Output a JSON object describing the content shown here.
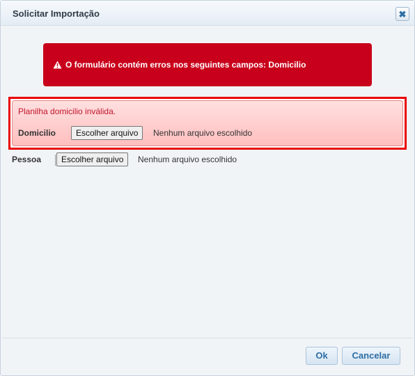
{
  "dialog": {
    "title": "Solicitar Importação",
    "close_icon": "close-icon"
  },
  "error_banner": {
    "icon": "warning-icon",
    "message": "O formulário contém erros nos seguintes campos: Domicilio",
    "color": "#c9001b"
  },
  "domicilio": {
    "error_message": "Planilha domicilio inválida.",
    "label": "Domicilio",
    "button_label": "Escolher arquivo",
    "status": "Nenhum arquivo escolhido"
  },
  "pessoa": {
    "label": "Pessoa",
    "button_label": "Escolher arquivo",
    "status": "Nenhum arquivo escolhido"
  },
  "footer": {
    "ok_label": "Ok",
    "cancel_label": "Cancelar"
  }
}
